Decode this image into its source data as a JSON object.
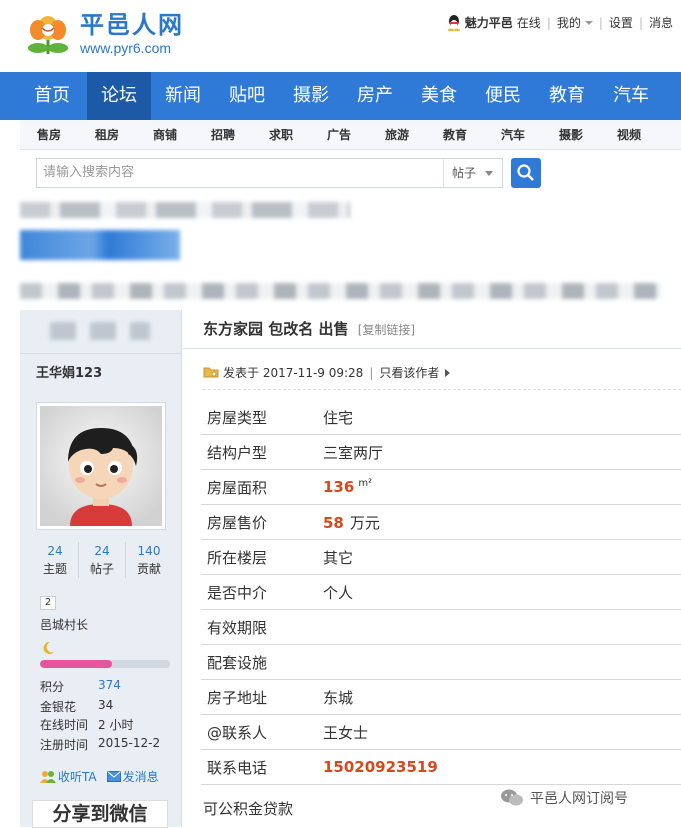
{
  "header": {
    "logo_name": "平邑人网",
    "logo_url": "www.pyr6.com",
    "top_links": {
      "user": "魅力平邑",
      "status": "在线",
      "mine": "我的",
      "settings": "设置",
      "messages": "消息"
    }
  },
  "nav": {
    "items": [
      "首页",
      "论坛",
      "新闻",
      "贴吧",
      "摄影",
      "房产",
      "美食",
      "便民",
      "教育",
      "汽车"
    ],
    "active": "论坛"
  },
  "subnav": {
    "items": [
      "售房",
      "租房",
      "商铺",
      "招聘",
      "求职",
      "广告",
      "旅游",
      "教育",
      "汽车",
      "摄影",
      "视频"
    ]
  },
  "search": {
    "placeholder": "请输入搜索内容",
    "scope": "帖子"
  },
  "sidebar": {
    "username": "王华娟123",
    "stats": [
      {
        "num": "24",
        "label": "主题"
      },
      {
        "num": "24",
        "label": "帖子"
      },
      {
        "num": "140",
        "label": "贡献"
      }
    ],
    "level": "2",
    "rank": "邑城村长",
    "progress_fraction": 0.55,
    "info": [
      {
        "k": "积分",
        "v": "374"
      },
      {
        "k": "金银花",
        "v": "34"
      },
      {
        "k": "在线时间",
        "v": "2 小时"
      },
      {
        "k": "注册时间",
        "v": "2015-12-2"
      }
    ],
    "actions": {
      "follow": "收听TA",
      "message": "发消息"
    },
    "share": "分享到微信"
  },
  "post": {
    "title": "东方家园 包改名 出售",
    "copy_link": "[复制链接]",
    "posted_at": "发表于 2017-11-9 09:28",
    "author_only": "只看该作者",
    "rows": [
      {
        "k": "房屋类型",
        "v": "住宅"
      },
      {
        "k": "结构户型",
        "v": "三室两厅"
      },
      {
        "k": "房屋面积",
        "v": "136",
        "unit": "m²"
      },
      {
        "k": "房屋售价",
        "v": "58",
        "unit": "万元"
      },
      {
        "k": "所在楼层",
        "v": "其它"
      },
      {
        "k": "是否中介",
        "v": "个人"
      },
      {
        "k": "有效期限",
        "v": ""
      },
      {
        "k": "配套设施",
        "v": ""
      },
      {
        "k": "房子地址",
        "v": "东城"
      },
      {
        "k": "@联系人",
        "v": "王女士"
      },
      {
        "k": "联系电话",
        "v": "15020923519"
      }
    ],
    "note": "可公积金贷款"
  },
  "watermark": "平邑人网订阅号",
  "colors": {
    "nav": "#2f7ad6",
    "nav_active": "#1c5aa8",
    "accent": "#2a78c8",
    "price_red": "#d44a1c",
    "progress": "#e6559a"
  }
}
